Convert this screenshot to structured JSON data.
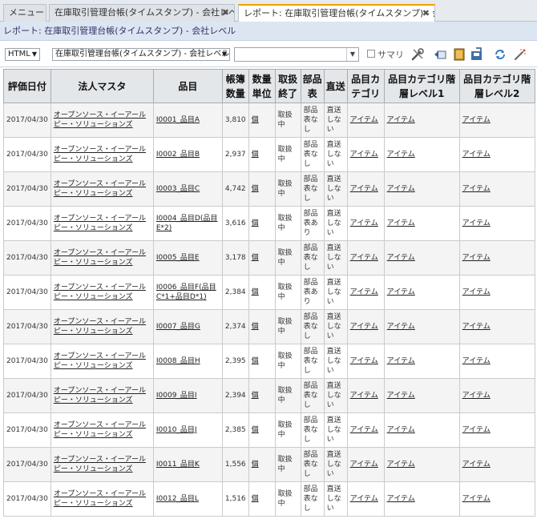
{
  "tabs": [
    {
      "label": "メニュー"
    },
    {
      "label": "在庫取引管理台帳(タイムスタンプ) - 会社レベル"
    },
    {
      "label": "レポート: 在庫取引管理台帳(タイムスタンプ) - 会..."
    }
  ],
  "breadcrumb": "レポート: 在庫取引管理台帳(タイムスタンプ) - 会社レベル",
  "toolbar": {
    "format": "HTML",
    "report": "在庫取引管理台帳(タイムスタンプ) - 会社レベル",
    "combo_value": "",
    "summary_label": "サマリ"
  },
  "table": {
    "headers": [
      "評価日付",
      "法人マスタ",
      "品目",
      "帳簿数量",
      "数量単位",
      "取扱終了",
      "部品表",
      "直送",
      "品目カテゴリ",
      "品目カテゴリ階層レベル1",
      "品目カテゴリ階層レベル2"
    ],
    "rows": [
      [
        "2017/04/30",
        "オープンソース・イーアールピー・ソリューションズ",
        "I0001_品目A",
        "3,810",
        "個",
        "取扱中",
        "部品表なし",
        "直送しない",
        "アイテム",
        "アイテム",
        "アイテム"
      ],
      [
        "2017/04/30",
        "オープンソース・イーアールピー・ソリューションズ",
        "I0002_品目B",
        "2,937",
        "個",
        "取扱中",
        "部品表なし",
        "直送しない",
        "アイテム",
        "アイテム",
        "アイテム"
      ],
      [
        "2017/04/30",
        "オープンソース・イーアールピー・ソリューションズ",
        "I0003_品目C",
        "4,742",
        "個",
        "取扱中",
        "部品表なし",
        "直送しない",
        "アイテム",
        "アイテム",
        "アイテム"
      ],
      [
        "2017/04/30",
        "オープンソース・イーアールピー・ソリューションズ",
        "I0004_品目D(品目E*2)",
        "3,616",
        "個",
        "取扱中",
        "部品表あり",
        "直送しない",
        "アイテム",
        "アイテム",
        "アイテム"
      ],
      [
        "2017/04/30",
        "オープンソース・イーアールピー・ソリューションズ",
        "I0005_品目E",
        "3,178",
        "個",
        "取扱中",
        "部品表なし",
        "直送しない",
        "アイテム",
        "アイテム",
        "アイテム"
      ],
      [
        "2017/04/30",
        "オープンソース・イーアールピー・ソリューションズ",
        "I0006_品目F(品目C*1+品目D*1)",
        "2,384",
        "個",
        "取扱中",
        "部品表あり",
        "直送しない",
        "アイテム",
        "アイテム",
        "アイテム"
      ],
      [
        "2017/04/30",
        "オープンソース・イーアールピー・ソリューションズ",
        "I0007_品目G",
        "2,374",
        "個",
        "取扱中",
        "部品表なし",
        "直送しない",
        "アイテム",
        "アイテム",
        "アイテム"
      ],
      [
        "2017/04/30",
        "オープンソース・イーアールピー・ソリューションズ",
        "I0008_品目H",
        "2,395",
        "個",
        "取扱中",
        "部品表なし",
        "直送しない",
        "アイテム",
        "アイテム",
        "アイテム"
      ],
      [
        "2017/04/30",
        "オープンソース・イーアールピー・ソリューションズ",
        "I0009_品目I",
        "2,394",
        "個",
        "取扱中",
        "部品表なし",
        "直送しない",
        "アイテム",
        "アイテム",
        "アイテム"
      ],
      [
        "2017/04/30",
        "オープンソース・イーアールピー・ソリューションズ",
        "I0010_品目J",
        "2,385",
        "個",
        "取扱中",
        "部品表なし",
        "直送しない",
        "アイテム",
        "アイテム",
        "アイテム"
      ],
      [
        "2017/04/30",
        "オープンソース・イーアールピー・ソリューションズ",
        "I0011_品目K",
        "1,556",
        "個",
        "取扱中",
        "部品表なし",
        "直送しない",
        "アイテム",
        "アイテム",
        "アイテム"
      ],
      [
        "2017/04/30",
        "オープンソース・イーアールピー・ソリューションズ",
        "I0012_品目L",
        "1,516",
        "個",
        "取扱中",
        "部品表なし",
        "直送しない",
        "アイテム",
        "アイテム",
        "アイテム"
      ]
    ]
  },
  "colors": {
    "accent_tab": "#f0a000",
    "title_strip": "#dbe6f2"
  },
  "icons": [
    "tools-icon",
    "back-icon",
    "book-icon",
    "save-icon",
    "refresh-icon",
    "wand-icon"
  ]
}
